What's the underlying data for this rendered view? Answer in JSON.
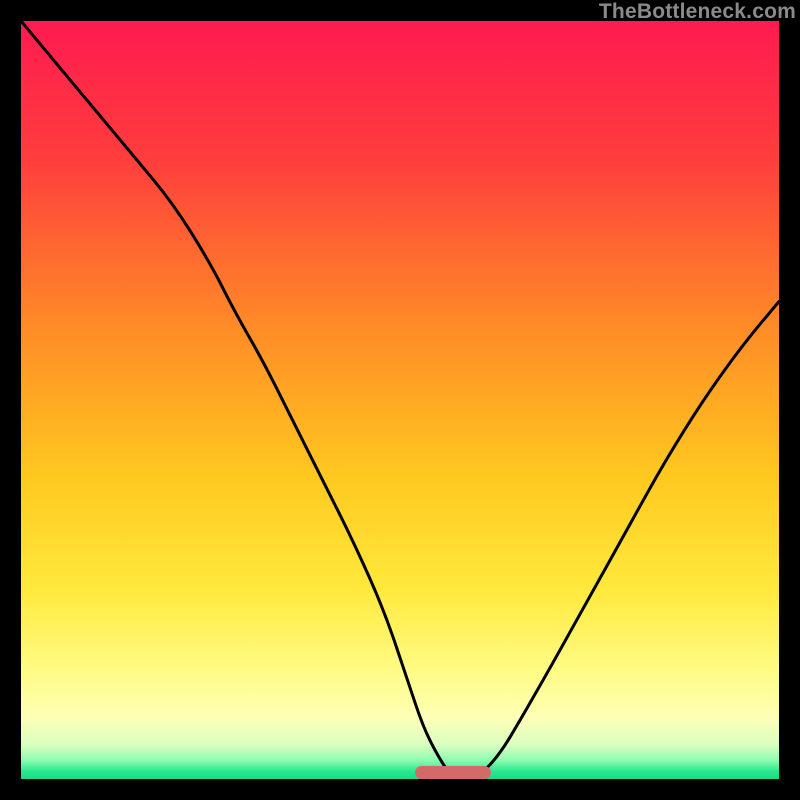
{
  "watermark": "TheBottleneck.com",
  "colors": {
    "frame": "#000000",
    "marker": "#d36a6a",
    "curve": "#000000",
    "gradient_stops": [
      {
        "offset": 0.0,
        "color": "#ff1b50"
      },
      {
        "offset": 0.18,
        "color": "#ff3d3d"
      },
      {
        "offset": 0.4,
        "color": "#ff8a27"
      },
      {
        "offset": 0.6,
        "color": "#ffc81f"
      },
      {
        "offset": 0.75,
        "color": "#ffe93c"
      },
      {
        "offset": 0.86,
        "color": "#fffc87"
      },
      {
        "offset": 0.92,
        "color": "#fdffb7"
      },
      {
        "offset": 0.955,
        "color": "#d9ffc0"
      },
      {
        "offset": 0.975,
        "color": "#8efcb0"
      },
      {
        "offset": 0.99,
        "color": "#27e88f"
      },
      {
        "offset": 1.0,
        "color": "#17dd86"
      }
    ]
  },
  "marker": {
    "x_percent": 57,
    "width_percent": 10
  },
  "chart_data": {
    "type": "line",
    "title": "",
    "xlabel": "",
    "ylabel": "",
    "ylim": [
      0,
      100
    ],
    "x": [
      0,
      5,
      10,
      15,
      20,
      25,
      28,
      32,
      36,
      40,
      44,
      48,
      51,
      53,
      55,
      57,
      60,
      63,
      66,
      70,
      75,
      80,
      85,
      90,
      95,
      100
    ],
    "values": [
      100,
      94,
      88,
      82,
      76,
      68,
      62,
      55,
      47,
      39,
      31,
      22,
      13,
      7,
      3,
      0,
      0,
      3,
      8,
      15,
      24,
      33,
      42,
      50,
      57,
      63
    ],
    "note": "x is relative horizontal position (%), values are approximate vertical height (%) of the black curve above the plot bottom, estimated from pixels; no axis ticks or labels are visible."
  }
}
